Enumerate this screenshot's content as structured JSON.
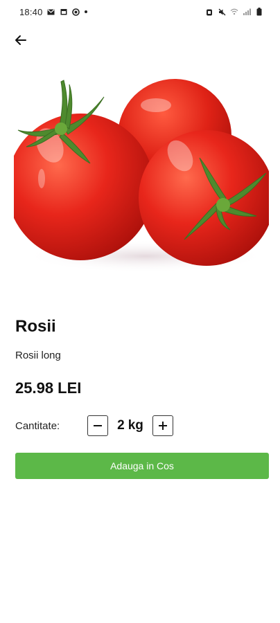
{
  "status_bar": {
    "time": "18:40",
    "left_icons": [
      "mail-icon",
      "calendar-icon",
      "sync-icon",
      "dot-icon"
    ],
    "right_icons": [
      "alarm-icon",
      "mute-icon",
      "wifi-icon",
      "signal-icon",
      "battery-icon"
    ]
  },
  "nav": {
    "back_icon": "arrow-left-icon"
  },
  "product": {
    "image_subject": "tomatoes",
    "name": "Rosii",
    "description": "Rosii long",
    "price": "25.98 LEI"
  },
  "quantity": {
    "label": "Cantitate:",
    "value": "2",
    "unit": "kg",
    "decrement_icon": "minus-icon",
    "increment_icon": "plus-icon"
  },
  "actions": {
    "add_to_cart_label": "Adauga in Cos"
  },
  "colors": {
    "accent": "#5cb848",
    "tomato_red": "#e3241b",
    "stem_green": "#4e8a2e",
    "text": "#111111",
    "background": "#ffffff"
  }
}
